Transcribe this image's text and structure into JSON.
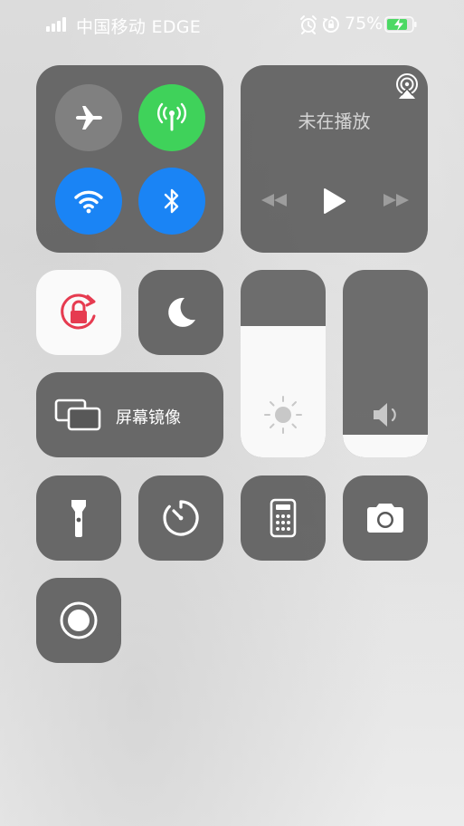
{
  "status_bar": {
    "carrier": "中国移动 EDGE",
    "battery_percent": "75%",
    "battery_level": 0.75,
    "charging": true
  },
  "connectivity": {
    "airplane_mode": false,
    "cellular_data": true,
    "wifi": true,
    "bluetooth": true
  },
  "media": {
    "status": "未在播放",
    "icons": [
      "airplay-icon",
      "previous-track-icon",
      "play-icon",
      "next-track-icon"
    ]
  },
  "toggles": {
    "orientation_lock": true,
    "do_not_disturb": false
  },
  "screen_mirroring": {
    "label": "屏幕镜像"
  },
  "sliders": {
    "brightness_level": 0.7,
    "volume_level": 0.12
  },
  "shortcuts": [
    "flashlight-icon",
    "timer-icon",
    "calculator-icon",
    "camera-icon",
    "screen-record-icon"
  ],
  "colors": {
    "cellular_active": "#3fd25a",
    "wifi_bluetooth_active": "#1a84f5",
    "orientation_lock_red": "#e63b50",
    "battery_green": "#4cd964"
  }
}
